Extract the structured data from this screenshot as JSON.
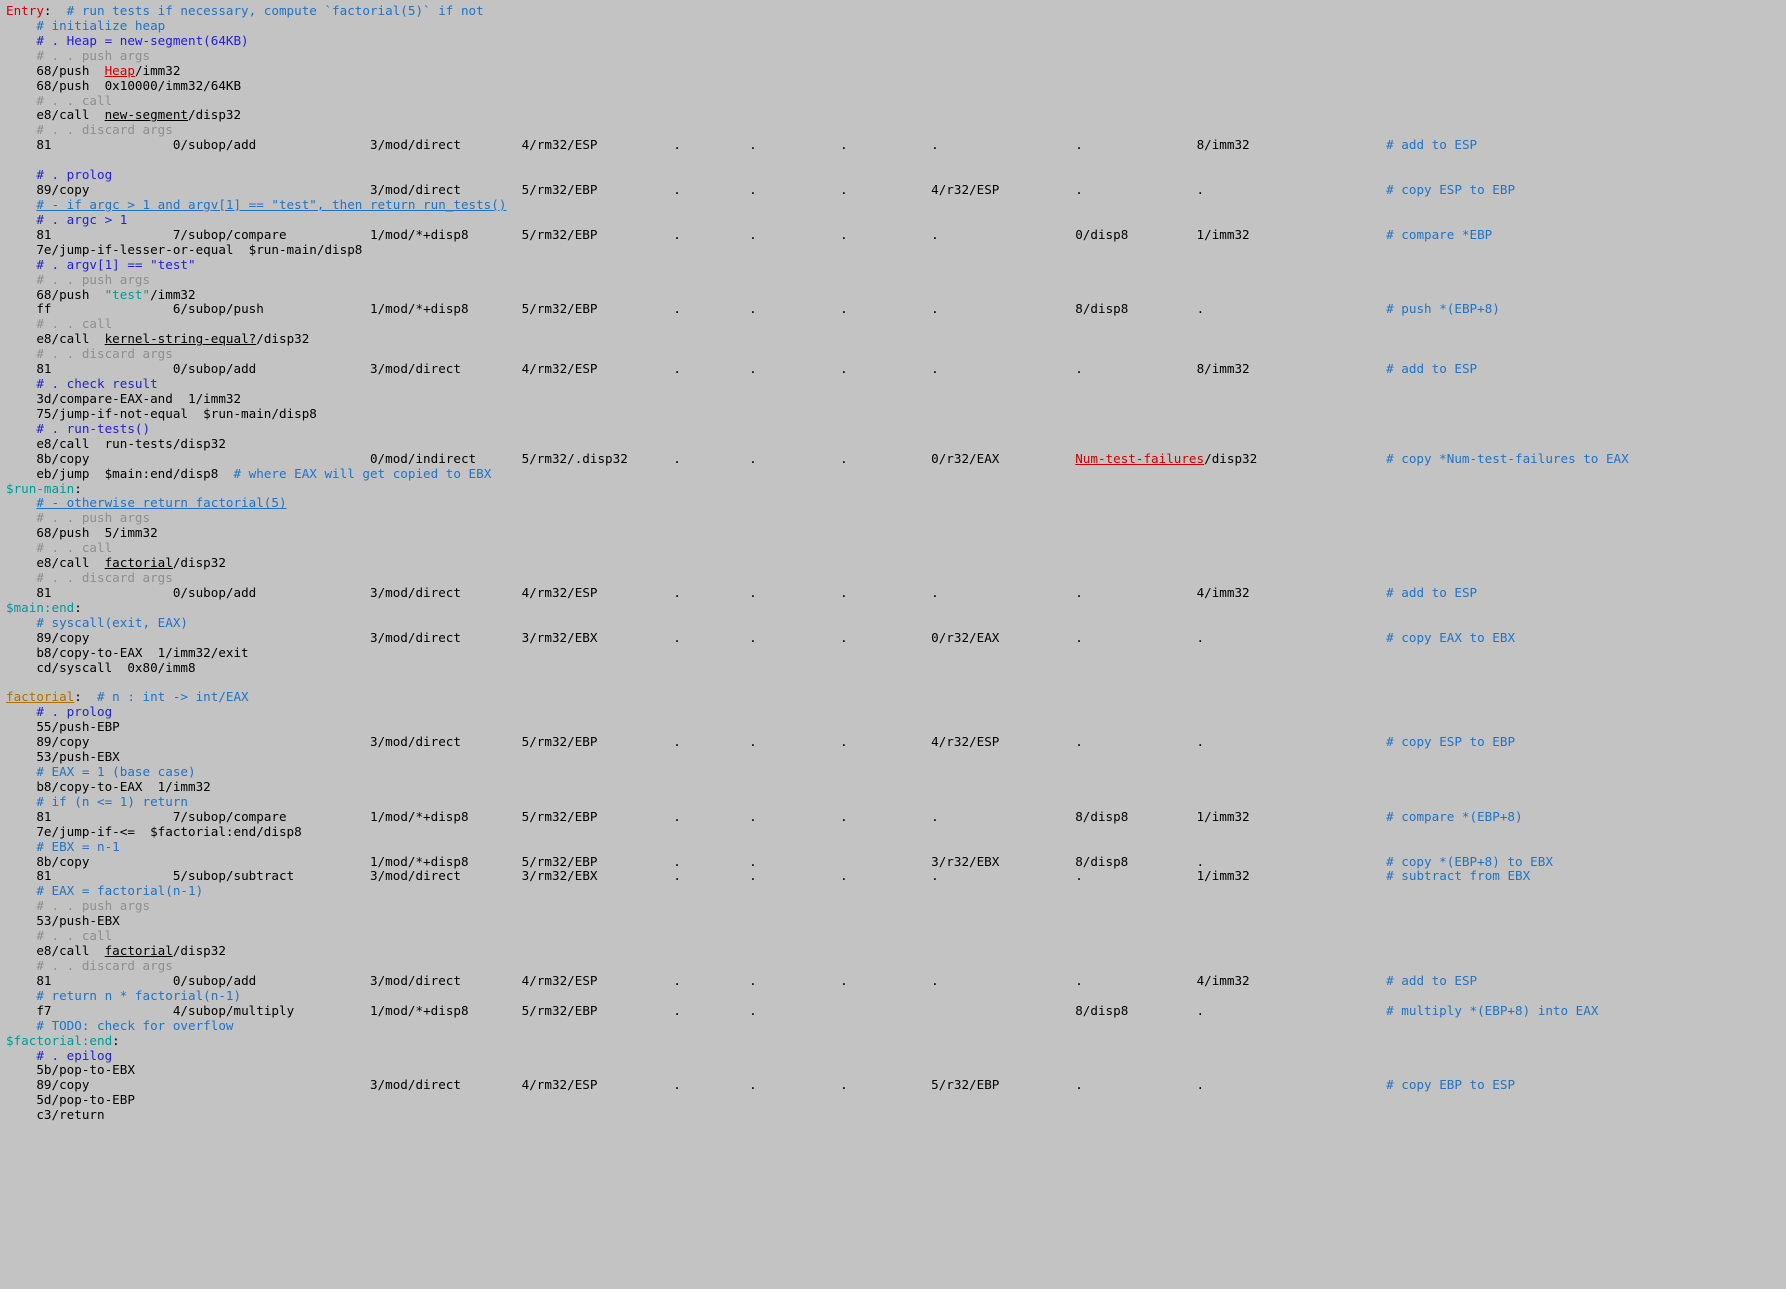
{
  "editor": {
    "background_color": "#c3c3c3",
    "font": "monospace",
    "palette": {
      "code": "#000000",
      "comment_primary": "#2222cc",
      "comment_secondary": "#2273c4",
      "comment_faint": "#8f8f8f",
      "label_global": "#d00000",
      "label_local": "#009a9a",
      "label_function": "#b07000",
      "string": "#009a9a"
    }
  },
  "lines": [
    {
      "id": 1,
      "indent": 0,
      "segs": [
        {
          "t": "Entry",
          "c": "label-red"
        },
        {
          "t": ":  ",
          "c": "code"
        },
        {
          "t": "# run tests if necessary, compute `factorial(5)` if not",
          "c": "comment"
        }
      ]
    },
    {
      "id": 2,
      "indent": 4,
      "segs": [
        {
          "t": "# initialize heap",
          "c": "comment"
        }
      ]
    },
    {
      "id": 3,
      "indent": 4,
      "segs": [
        {
          "t": "# . Heap = new-segment(64KB)",
          "c": "comment-hi"
        }
      ]
    },
    {
      "id": 4,
      "indent": 4,
      "segs": [
        {
          "t": "# . . push args",
          "c": "faint"
        }
      ]
    },
    {
      "id": 5,
      "indent": 4,
      "segs": [
        {
          "t": "68/push  ",
          "c": "code"
        },
        {
          "t": "Heap",
          "c": "label-red-u"
        },
        {
          "t": "/imm32",
          "c": "code"
        }
      ]
    },
    {
      "id": 6,
      "indent": 4,
      "segs": [
        {
          "t": "68/push  0x10000/imm32/64KB",
          "c": "code"
        }
      ]
    },
    {
      "id": 7,
      "indent": 4,
      "segs": [
        {
          "t": "# . . call",
          "c": "faint"
        }
      ]
    },
    {
      "id": 8,
      "indent": 4,
      "segs": [
        {
          "t": "e8/call  ",
          "c": "code"
        },
        {
          "t": "new-segment",
          "c": "code-ul"
        },
        {
          "t": "/disp32",
          "c": "code"
        }
      ]
    },
    {
      "id": 9,
      "indent": 4,
      "segs": [
        {
          "t": "# . . discard args",
          "c": "faint"
        }
      ]
    },
    {
      "id": 10,
      "indent": 4,
      "cols": {
        "op": "81",
        "subop": "0/subop/add",
        "mod": "3/mod/direct",
        "rm32": "4/rm32/ESP",
        "base": ".",
        "index": ".",
        "scale": ".",
        "r32": ".",
        "disp": ".",
        "imm": "8/imm32",
        "comment": "# add to ESP"
      }
    },
    {
      "id": 11,
      "indent": 0,
      "segs": []
    },
    {
      "id": 12,
      "indent": 4,
      "segs": [
        {
          "t": "# . prolog",
          "c": "comment-hi"
        }
      ]
    },
    {
      "id": 13,
      "indent": 4,
      "cols": {
        "op": "89/copy",
        "subop": "",
        "mod": "3/mod/direct",
        "rm32": "5/rm32/EBP",
        "base": ".",
        "index": ".",
        "scale": ".",
        "r32": "4/r32/ESP",
        "disp": ".",
        "imm": ".",
        "comment": "# copy ESP to EBP"
      }
    },
    {
      "id": 14,
      "indent": 4,
      "segs": [
        {
          "t": "# - if argc > 1 and argv[1] == \"test\", then return run_tests()",
          "c": "comment-u"
        }
      ]
    },
    {
      "id": 15,
      "indent": 4,
      "segs": [
        {
          "t": "# . argc > 1",
          "c": "comment-hi"
        }
      ]
    },
    {
      "id": 16,
      "indent": 4,
      "cols": {
        "op": "81",
        "subop": "7/subop/compare",
        "mod": "1/mod/*+disp8",
        "rm32": "5/rm32/EBP",
        "base": ".",
        "index": ".",
        "scale": ".",
        "r32": ".",
        "disp": "0/disp8",
        "imm": "1/imm32",
        "comment": "# compare *EBP"
      }
    },
    {
      "id": 17,
      "indent": 4,
      "segs": [
        {
          "t": "7e/jump-if-lesser-or-equal  $run-main/disp8",
          "c": "code"
        }
      ]
    },
    {
      "id": 18,
      "indent": 4,
      "segs": [
        {
          "t": "# . argv[1] == \"test\"",
          "c": "comment-hi"
        }
      ]
    },
    {
      "id": 19,
      "indent": 4,
      "segs": [
        {
          "t": "# . . push args",
          "c": "faint"
        }
      ]
    },
    {
      "id": 20,
      "indent": 4,
      "segs": [
        {
          "t": "68/push  ",
          "c": "code"
        },
        {
          "t": "\"test\"",
          "c": "str"
        },
        {
          "t": "/imm32",
          "c": "code"
        }
      ]
    },
    {
      "id": 21,
      "indent": 4,
      "cols": {
        "op": "ff",
        "subop": "6/subop/push",
        "mod": "1/mod/*+disp8",
        "rm32": "5/rm32/EBP",
        "base": ".",
        "index": ".",
        "scale": ".",
        "r32": ".",
        "disp": "8/disp8",
        "imm": ".",
        "comment": "# push *(EBP+8)"
      }
    },
    {
      "id": 22,
      "indent": 4,
      "segs": [
        {
          "t": "# . . call",
          "c": "faint"
        }
      ]
    },
    {
      "id": 23,
      "indent": 4,
      "segs": [
        {
          "t": "e8/call  ",
          "c": "code"
        },
        {
          "t": "kernel-string-equal?",
          "c": "code-ul"
        },
        {
          "t": "/disp32",
          "c": "code"
        }
      ]
    },
    {
      "id": 24,
      "indent": 4,
      "segs": [
        {
          "t": "# . . discard args",
          "c": "faint"
        }
      ]
    },
    {
      "id": 25,
      "indent": 4,
      "cols": {
        "op": "81",
        "subop": "0/subop/add",
        "mod": "3/mod/direct",
        "rm32": "4/rm32/ESP",
        "base": ".",
        "index": ".",
        "scale": ".",
        "r32": ".",
        "disp": ".",
        "imm": "8/imm32",
        "comment": "# add to ESP"
      }
    },
    {
      "id": 26,
      "indent": 4,
      "segs": [
        {
          "t": "# . check result",
          "c": "comment-hi"
        }
      ]
    },
    {
      "id": 27,
      "indent": 4,
      "segs": [
        {
          "t": "3d/compare-EAX-and  1/imm32",
          "c": "code"
        }
      ]
    },
    {
      "id": 28,
      "indent": 4,
      "segs": [
        {
          "t": "75/jump-if-not-equal  $run-main/disp8",
          "c": "code"
        }
      ]
    },
    {
      "id": 29,
      "indent": 4,
      "segs": [
        {
          "t": "# . run-tests()",
          "c": "comment-hi"
        }
      ]
    },
    {
      "id": 30,
      "indent": 4,
      "segs": [
        {
          "t": "e8/call  run-tests/disp32",
          "c": "code"
        }
      ]
    },
    {
      "id": 31,
      "indent": 4,
      "cols": {
        "op": "8b/copy",
        "subop": "",
        "mod": "0/mod/indirect",
        "rm32": "5/rm32/.disp32",
        "base": ".",
        "index": ".",
        "scale": ".",
        "r32": "0/r32/EAX",
        "disp": "@Num-test-failures/disp32",
        "imm": "",
        "comment": "# copy *Num-test-failures to EAX"
      }
    },
    {
      "id": 32,
      "indent": 4,
      "segs": [
        {
          "t": "eb/jump  $main:end/disp8  ",
          "c": "code"
        },
        {
          "t": "# where EAX will get copied to EBX",
          "c": "comment"
        }
      ]
    },
    {
      "id": 33,
      "indent": 0,
      "segs": [
        {
          "t": "$run-main",
          "c": "label-teal"
        },
        {
          "t": ":",
          "c": "code"
        }
      ]
    },
    {
      "id": 34,
      "indent": 4,
      "segs": [
        {
          "t": "# - otherwise return factorial(5)",
          "c": "comment-u"
        }
      ]
    },
    {
      "id": 35,
      "indent": 4,
      "segs": [
        {
          "t": "# . . push args",
          "c": "faint"
        }
      ]
    },
    {
      "id": 36,
      "indent": 4,
      "segs": [
        {
          "t": "68/push  5/imm32",
          "c": "code"
        }
      ]
    },
    {
      "id": 37,
      "indent": 4,
      "segs": [
        {
          "t": "# . . call",
          "c": "faint"
        }
      ]
    },
    {
      "id": 38,
      "indent": 4,
      "segs": [
        {
          "t": "e8/call  ",
          "c": "code"
        },
        {
          "t": "factorial",
          "c": "code-ul"
        },
        {
          "t": "/disp32",
          "c": "code"
        }
      ]
    },
    {
      "id": 39,
      "indent": 4,
      "segs": [
        {
          "t": "# . . discard args",
          "c": "faint"
        }
      ]
    },
    {
      "id": 40,
      "indent": 4,
      "cols": {
        "op": "81",
        "subop": "0/subop/add",
        "mod": "3/mod/direct",
        "rm32": "4/rm32/ESP",
        "base": ".",
        "index": ".",
        "scale": ".",
        "r32": ".",
        "disp": ".",
        "imm": "4/imm32",
        "comment": "# add to ESP"
      }
    },
    {
      "id": 41,
      "indent": 0,
      "segs": [
        {
          "t": "$main:end",
          "c": "label-teal"
        },
        {
          "t": ":",
          "c": "code"
        }
      ]
    },
    {
      "id": 42,
      "indent": 4,
      "segs": [
        {
          "t": "# syscall(exit, EAX)",
          "c": "comment"
        }
      ]
    },
    {
      "id": 43,
      "indent": 4,
      "cols": {
        "op": "89/copy",
        "subop": "",
        "mod": "3/mod/direct",
        "rm32": "3/rm32/EBX",
        "base": ".",
        "index": ".",
        "scale": ".",
        "r32": "0/r32/EAX",
        "disp": ".",
        "imm": ".",
        "comment": "# copy EAX to EBX"
      }
    },
    {
      "id": 44,
      "indent": 4,
      "segs": [
        {
          "t": "b8/copy-to-EAX  1/imm32/exit",
          "c": "code"
        }
      ]
    },
    {
      "id": 45,
      "indent": 4,
      "segs": [
        {
          "t": "cd/syscall  0x80/imm8",
          "c": "code"
        }
      ]
    },
    {
      "id": 46,
      "indent": 0,
      "segs": []
    },
    {
      "id": 47,
      "indent": 0,
      "segs": [
        {
          "t": "factorial",
          "c": "label-gold"
        },
        {
          "t": ":  ",
          "c": "code"
        },
        {
          "t": "# n : int -> int/EAX",
          "c": "comment"
        }
      ]
    },
    {
      "id": 48,
      "indent": 4,
      "segs": [
        {
          "t": "# . prolog",
          "c": "comment-hi"
        }
      ]
    },
    {
      "id": 49,
      "indent": 4,
      "segs": [
        {
          "t": "55/push-EBP",
          "c": "code"
        }
      ]
    },
    {
      "id": 50,
      "indent": 4,
      "cols": {
        "op": "89/copy",
        "subop": "",
        "mod": "3/mod/direct",
        "rm32": "5/rm32/EBP",
        "base": ".",
        "index": ".",
        "scale": ".",
        "r32": "4/r32/ESP",
        "disp": ".",
        "imm": ".",
        "comment": "# copy ESP to EBP"
      }
    },
    {
      "id": 51,
      "indent": 4,
      "segs": [
        {
          "t": "53/push-EBX",
          "c": "code"
        }
      ]
    },
    {
      "id": 52,
      "indent": 4,
      "segs": [
        {
          "t": "# EAX = 1 (base case)",
          "c": "comment"
        }
      ]
    },
    {
      "id": 53,
      "indent": 4,
      "segs": [
        {
          "t": "b8/copy-to-EAX  1/imm32",
          "c": "code"
        }
      ]
    },
    {
      "id": 54,
      "indent": 4,
      "segs": [
        {
          "t": "# if (n <= 1) return",
          "c": "comment"
        }
      ]
    },
    {
      "id": 55,
      "indent": 4,
      "cols": {
        "op": "81",
        "subop": "7/subop/compare",
        "mod": "1/mod/*+disp8",
        "rm32": "5/rm32/EBP",
        "base": ".",
        "index": ".",
        "scale": ".",
        "r32": ".",
        "disp": "8/disp8",
        "imm": "1/imm32",
        "comment": "# compare *(EBP+8)"
      }
    },
    {
      "id": 56,
      "indent": 4,
      "segs": [
        {
          "t": "7e/jump-if-<=  $factorial:end/disp8",
          "c": "code"
        }
      ]
    },
    {
      "id": 57,
      "indent": 4,
      "segs": [
        {
          "t": "# EBX = n-1",
          "c": "comment"
        }
      ]
    },
    {
      "id": 58,
      "indent": 4,
      "cols": {
        "op": "8b/copy",
        "subop": "",
        "mod": "1/mod/*+disp8",
        "rm32": "5/rm32/EBP",
        "base": ".",
        "index": ".",
        "scale": "",
        "r32": "3/r32/EBX",
        "disp": "8/disp8",
        "imm": ".",
        "comment": "# copy *(EBP+8) to EBX"
      }
    },
    {
      "id": 59,
      "indent": 4,
      "cols": {
        "op": "81",
        "subop": "5/subop/subtract",
        "mod": "3/mod/direct",
        "rm32": "3/rm32/EBX",
        "base": ".",
        "index": ".",
        "scale": ".",
        "r32": ".",
        "disp": ".",
        "imm": "1/imm32",
        "comment": "# subtract from EBX"
      }
    },
    {
      "id": 60,
      "indent": 4,
      "segs": [
        {
          "t": "# EAX = factorial(n-1)",
          "c": "comment"
        }
      ]
    },
    {
      "id": 61,
      "indent": 4,
      "segs": [
        {
          "t": "# . . push args",
          "c": "faint"
        }
      ]
    },
    {
      "id": 62,
      "indent": 4,
      "segs": [
        {
          "t": "53/push-EBX",
          "c": "code"
        }
      ]
    },
    {
      "id": 63,
      "indent": 4,
      "segs": [
        {
          "t": "# . . call",
          "c": "faint"
        }
      ]
    },
    {
      "id": 64,
      "indent": 4,
      "segs": [
        {
          "t": "e8/call  ",
          "c": "code"
        },
        {
          "t": "factorial",
          "c": "code-ul"
        },
        {
          "t": "/disp32",
          "c": "code"
        }
      ]
    },
    {
      "id": 65,
      "indent": 4,
      "segs": [
        {
          "t": "# . . discard args",
          "c": "faint"
        }
      ]
    },
    {
      "id": 66,
      "indent": 4,
      "cols": {
        "op": "81",
        "subop": "0/subop/add",
        "mod": "3/mod/direct",
        "rm32": "4/rm32/ESP",
        "base": ".",
        "index": ".",
        "scale": ".",
        "r32": ".",
        "disp": ".",
        "imm": "4/imm32",
        "comment": "# add to ESP"
      }
    },
    {
      "id": 67,
      "indent": 4,
      "segs": [
        {
          "t": "# return n * factorial(n-1)",
          "c": "comment"
        }
      ]
    },
    {
      "id": 68,
      "indent": 4,
      "cols": {
        "op": "f7",
        "subop": "4/subop/multiply",
        "mod": "1/mod/*+disp8",
        "rm32": "5/rm32/EBP",
        "base": ".",
        "index": ".",
        "scale": "",
        "r32": "",
        "disp": "8/disp8",
        "imm": ".",
        "comment": "# multiply *(EBP+8) into EAX"
      }
    },
    {
      "id": 69,
      "indent": 4,
      "segs": [
        {
          "t": "# TODO: check for overflow",
          "c": "comment"
        }
      ]
    },
    {
      "id": 70,
      "indent": 0,
      "segs": [
        {
          "t": "$factorial:end",
          "c": "label-teal"
        },
        {
          "t": ":",
          "c": "code"
        }
      ]
    },
    {
      "id": 71,
      "indent": 4,
      "segs": [
        {
          "t": "# . epilog",
          "c": "comment-hi"
        }
      ]
    },
    {
      "id": 72,
      "indent": 4,
      "segs": [
        {
          "t": "5b/pop-to-EBX",
          "c": "code"
        }
      ]
    },
    {
      "id": 73,
      "indent": 4,
      "cols": {
        "op": "89/copy",
        "subop": "",
        "mod": "3/mod/direct",
        "rm32": "4/rm32/ESP",
        "base": ".",
        "index": ".",
        "scale": ".",
        "r32": "5/r32/EBP",
        "disp": ".",
        "imm": ".",
        "comment": "# copy EBP to ESP"
      }
    },
    {
      "id": 74,
      "indent": 4,
      "segs": [
        {
          "t": "5d/pop-to-EBP",
          "c": "code"
        }
      ]
    },
    {
      "id": 75,
      "indent": 4,
      "segs": [
        {
          "t": "c3/return",
          "c": "code"
        }
      ]
    }
  ],
  "columns": {
    "op": 4,
    "subop": 22,
    "mod": 48,
    "rm32": 68,
    "base": 88,
    "index": 98,
    "scale": 110,
    "r32": 122,
    "disp": 141,
    "imm": 157,
    "comment": 182
  }
}
